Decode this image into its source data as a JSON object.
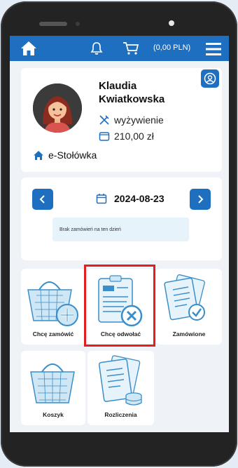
{
  "header": {
    "cart_total": "(0,00 PLN)",
    "icons": [
      "home-icon",
      "bell-icon",
      "cart-icon",
      "menu-icon"
    ]
  },
  "user": {
    "first_name": "Klaudia",
    "last_name": "Kwiatkowska",
    "plan": "wyżywienie",
    "balance": "210,00 zł",
    "school": "e-Stołówka"
  },
  "date_panel": {
    "date": "2024-08-23",
    "info": "Brak zamówień na ten dzień"
  },
  "tiles": [
    {
      "label": "Chcę zamówić",
      "icon": "basket-plus-icon"
    },
    {
      "label": "Chcę odwołać",
      "icon": "clipboard-cancel-icon"
    },
    {
      "label": "Zamówione",
      "icon": "clipboard-check-icon"
    },
    {
      "label": "Koszyk",
      "icon": "basket-icon"
    },
    {
      "label": "Rozliczenia",
      "icon": "billing-icon"
    }
  ],
  "colors": {
    "primary": "#1f6fc1",
    "highlight": "#e02020",
    "icon_line": "#3a8ec9",
    "icon_fill": "#cfe6f5"
  }
}
